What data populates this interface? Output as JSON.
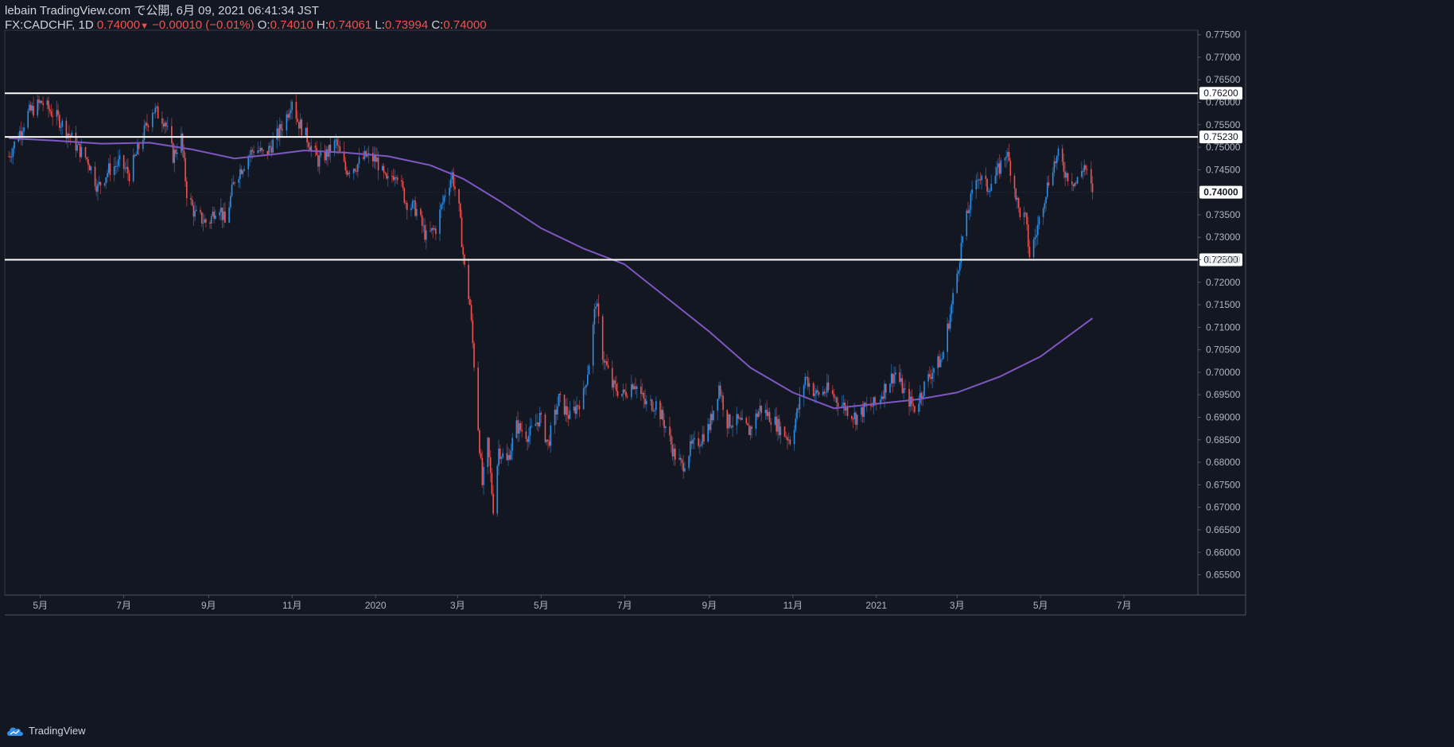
{
  "header": {
    "line1": "lebain TradingView.com で公開, 6月 09, 2021 06:41:34 JST",
    "symbol": "FX:CADCHF, 1D",
    "last": "0.74000",
    "change_arrow": "▼",
    "change": "−0.00010 (−0.01%)",
    "o_label": "O:",
    "o_value": "0.74010",
    "h_label": "H:",
    "h_value": "0.74061",
    "l_label": "L:",
    "l_value": "0.73994",
    "c_label": "C:",
    "c_value": "0.74000"
  },
  "footer": {
    "brand": "TradingView",
    "icon": "tradingview-cloud-icon"
  },
  "colors": {
    "background": "#131722",
    "up": "#2f8ee6",
    "down": "#ef5350",
    "ma": "#7e57c2",
    "level": "#ffffff"
  },
  "chart_data": {
    "type": "candlestick",
    "symbol": "FX:CADCHF",
    "interval": "1D",
    "ylim": [
      0.6505,
      0.776
    ],
    "y_ticks": [
      "0.77500",
      "0.77000",
      "0.76500",
      "0.76000",
      "0.75500",
      "0.75000",
      "0.74500",
      "0.74000",
      "0.73500",
      "0.73000",
      "0.72500",
      "0.72000",
      "0.71500",
      "0.71000",
      "0.70500",
      "0.70000",
      "0.69500",
      "0.69000",
      "0.68500",
      "0.68000",
      "0.67500",
      "0.67000",
      "0.66500",
      "0.66000",
      "0.65500"
    ],
    "y_tick_values": [
      0.775,
      0.77,
      0.765,
      0.76,
      0.755,
      0.75,
      0.745,
      0.74,
      0.735,
      0.73,
      0.725,
      0.72,
      0.715,
      0.71,
      0.705,
      0.7,
      0.695,
      0.69,
      0.685,
      0.68,
      0.675,
      0.67,
      0.665,
      0.66,
      0.655
    ],
    "x_ticks": [
      {
        "label": "5月",
        "date": "2019-05-01"
      },
      {
        "label": "7月",
        "date": "2019-07-01"
      },
      {
        "label": "9月",
        "date": "2019-09-01"
      },
      {
        "label": "11月",
        "date": "2019-11-01"
      },
      {
        "label": "2020",
        "date": "2020-01-01"
      },
      {
        "label": "3月",
        "date": "2020-03-01"
      },
      {
        "label": "5月",
        "date": "2020-05-01"
      },
      {
        "label": "7月",
        "date": "2020-07-01"
      },
      {
        "label": "9月",
        "date": "2020-09-01"
      },
      {
        "label": "11月",
        "date": "2020-11-01"
      },
      {
        "label": "2021",
        "date": "2021-01-01"
      },
      {
        "label": "3月",
        "date": "2021-03-01"
      },
      {
        "label": "5月",
        "date": "2021-05-01"
      },
      {
        "label": "7月",
        "date": "2021-07-01"
      }
    ],
    "price_path": [
      [
        "2019-04-08",
        0.748
      ],
      [
        "2019-04-22",
        0.7575
      ],
      [
        "2019-05-02",
        0.76
      ],
      [
        "2019-05-15",
        0.756
      ],
      [
        "2019-05-28",
        0.75
      ],
      [
        "2019-06-05",
        0.747
      ],
      [
        "2019-06-12",
        0.741
      ],
      [
        "2019-06-20",
        0.745
      ],
      [
        "2019-06-28",
        0.7465
      ],
      [
        "2019-07-05",
        0.744
      ],
      [
        "2019-07-12",
        0.75
      ],
      [
        "2019-07-22",
        0.7585
      ],
      [
        "2019-07-31",
        0.756
      ],
      [
        "2019-08-06",
        0.748
      ],
      [
        "2019-08-12",
        0.752
      ],
      [
        "2019-08-16",
        0.74
      ],
      [
        "2019-08-22",
        0.735
      ],
      [
        "2019-09-01",
        0.733
      ],
      [
        "2019-09-08",
        0.738
      ],
      [
        "2019-09-13",
        0.733
      ],
      [
        "2019-09-20",
        0.743
      ],
      [
        "2019-09-30",
        0.748
      ],
      [
        "2019-10-05",
        0.75
      ],
      [
        "2019-10-12",
        0.748
      ],
      [
        "2019-10-20",
        0.752
      ],
      [
        "2019-10-27",
        0.756
      ],
      [
        "2019-11-01",
        0.761
      ],
      [
        "2019-11-05",
        0.756
      ],
      [
        "2019-11-12",
        0.752
      ],
      [
        "2019-11-20",
        0.747
      ],
      [
        "2019-11-28",
        0.749
      ],
      [
        "2019-12-03",
        0.751
      ],
      [
        "2019-12-10",
        0.745
      ],
      [
        "2019-12-18",
        0.746
      ],
      [
        "2019-12-25",
        0.748
      ],
      [
        "2020-01-02",
        0.747
      ],
      [
        "2020-01-09",
        0.742
      ],
      [
        "2020-01-16",
        0.745
      ],
      [
        "2020-01-23",
        0.738
      ],
      [
        "2020-01-31",
        0.736
      ],
      [
        "2020-02-07",
        0.73
      ],
      [
        "2020-02-14",
        0.732
      ],
      [
        "2020-02-21",
        0.74
      ],
      [
        "2020-02-26",
        0.744
      ],
      [
        "2020-03-02",
        0.736
      ],
      [
        "2020-03-06",
        0.723
      ],
      [
        "2020-03-10",
        0.715
      ],
      [
        "2020-03-13",
        0.702
      ],
      [
        "2020-03-16",
        0.688
      ],
      [
        "2020-03-19",
        0.675
      ],
      [
        "2020-03-23",
        0.684
      ],
      [
        "2020-03-27",
        0.67
      ],
      [
        "2020-03-31",
        0.683
      ],
      [
        "2020-04-06",
        0.68
      ],
      [
        "2020-04-13",
        0.688
      ],
      [
        "2020-04-22",
        0.686
      ],
      [
        "2020-04-30",
        0.69
      ],
      [
        "2020-05-06",
        0.684
      ],
      [
        "2020-05-14",
        0.694
      ],
      [
        "2020-05-22",
        0.69
      ],
      [
        "2020-06-01",
        0.695
      ],
      [
        "2020-06-06",
        0.704
      ],
      [
        "2020-06-10",
        0.716
      ],
      [
        "2020-06-15",
        0.704
      ],
      [
        "2020-06-22",
        0.697
      ],
      [
        "2020-06-30",
        0.695
      ],
      [
        "2020-07-08",
        0.698
      ],
      [
        "2020-07-16",
        0.693
      ],
      [
        "2020-07-24",
        0.693
      ],
      [
        "2020-07-31",
        0.688
      ],
      [
        "2020-08-06",
        0.682
      ],
      [
        "2020-08-12",
        0.679
      ],
      [
        "2020-08-18",
        0.683
      ],
      [
        "2020-08-25",
        0.685
      ],
      [
        "2020-09-01",
        0.688
      ],
      [
        "2020-09-08",
        0.697
      ],
      [
        "2020-09-14",
        0.689
      ],
      [
        "2020-09-22",
        0.689
      ],
      [
        "2020-09-30",
        0.687
      ],
      [
        "2020-10-08",
        0.692
      ],
      [
        "2020-10-16",
        0.69
      ],
      [
        "2020-10-24",
        0.687
      ],
      [
        "2020-10-30",
        0.685
      ],
      [
        "2020-11-05",
        0.692
      ],
      [
        "2020-11-10",
        0.699
      ],
      [
        "2020-11-18",
        0.695
      ],
      [
        "2020-11-26",
        0.696
      ],
      [
        "2020-12-03",
        0.694
      ],
      [
        "2020-12-10",
        0.692
      ],
      [
        "2020-12-17",
        0.69
      ],
      [
        "2020-12-24",
        0.692
      ],
      [
        "2021-01-01",
        0.693
      ],
      [
        "2021-01-08",
        0.697
      ],
      [
        "2021-01-15",
        0.7
      ],
      [
        "2021-01-22",
        0.695
      ],
      [
        "2021-01-29",
        0.692
      ],
      [
        "2021-02-05",
        0.697
      ],
      [
        "2021-02-12",
        0.701
      ],
      [
        "2021-02-18",
        0.703
      ],
      [
        "2021-02-24",
        0.713
      ],
      [
        "2021-03-01",
        0.722
      ],
      [
        "2021-03-05",
        0.73
      ],
      [
        "2021-03-10",
        0.737
      ],
      [
        "2021-03-16",
        0.744
      ],
      [
        "2021-03-23",
        0.741
      ],
      [
        "2021-03-30",
        0.744
      ],
      [
        "2021-04-06",
        0.749
      ],
      [
        "2021-04-11",
        0.743
      ],
      [
        "2021-04-15",
        0.736
      ],
      [
        "2021-04-20",
        0.734
      ],
      [
        "2021-04-23",
        0.726
      ],
      [
        "2021-04-28",
        0.731
      ],
      [
        "2021-05-03",
        0.738
      ],
      [
        "2021-05-10",
        0.746
      ],
      [
        "2021-05-14",
        0.748
      ],
      [
        "2021-05-20",
        0.744
      ],
      [
        "2021-05-27",
        0.742
      ],
      [
        "2021-06-02",
        0.746
      ],
      [
        "2021-06-08",
        0.74
      ]
    ],
    "last_close": 0.74,
    "moving_average": {
      "name": "MA",
      "points": [
        [
          "2019-04-08",
          0.752
        ],
        [
          "2019-05-10",
          0.7515
        ],
        [
          "2019-06-15",
          0.7508
        ],
        [
          "2019-07-20",
          0.751
        ],
        [
          "2019-08-20",
          0.7495
        ],
        [
          "2019-09-20",
          0.7475
        ],
        [
          "2019-10-20",
          0.7485
        ],
        [
          "2019-11-10",
          0.7493
        ],
        [
          "2019-12-10",
          0.7488
        ],
        [
          "2020-01-10",
          0.748
        ],
        [
          "2020-02-10",
          0.746
        ],
        [
          "2020-03-05",
          0.743
        ],
        [
          "2020-04-01",
          0.738
        ],
        [
          "2020-05-01",
          0.732
        ],
        [
          "2020-06-01",
          0.7275
        ],
        [
          "2020-07-01",
          0.724
        ],
        [
          "2020-08-01",
          0.7165
        ],
        [
          "2020-09-01",
          0.709
        ],
        [
          "2020-10-01",
          0.701
        ],
        [
          "2020-11-01",
          0.6955
        ],
        [
          "2020-12-01",
          0.692
        ],
        [
          "2021-01-01",
          0.693
        ],
        [
          "2021-02-01",
          0.694
        ],
        [
          "2021-03-01",
          0.6955
        ],
        [
          "2021-04-01",
          0.699
        ],
        [
          "2021-05-01",
          0.7035
        ],
        [
          "2021-06-08",
          0.712
        ]
      ]
    },
    "levels": [
      {
        "value": 0.762,
        "label": "0.76200"
      },
      {
        "value": 0.7523,
        "label": "0.75230"
      },
      {
        "value": 0.725,
        "label": "0.72500"
      }
    ],
    "last_label": "0.74000"
  }
}
